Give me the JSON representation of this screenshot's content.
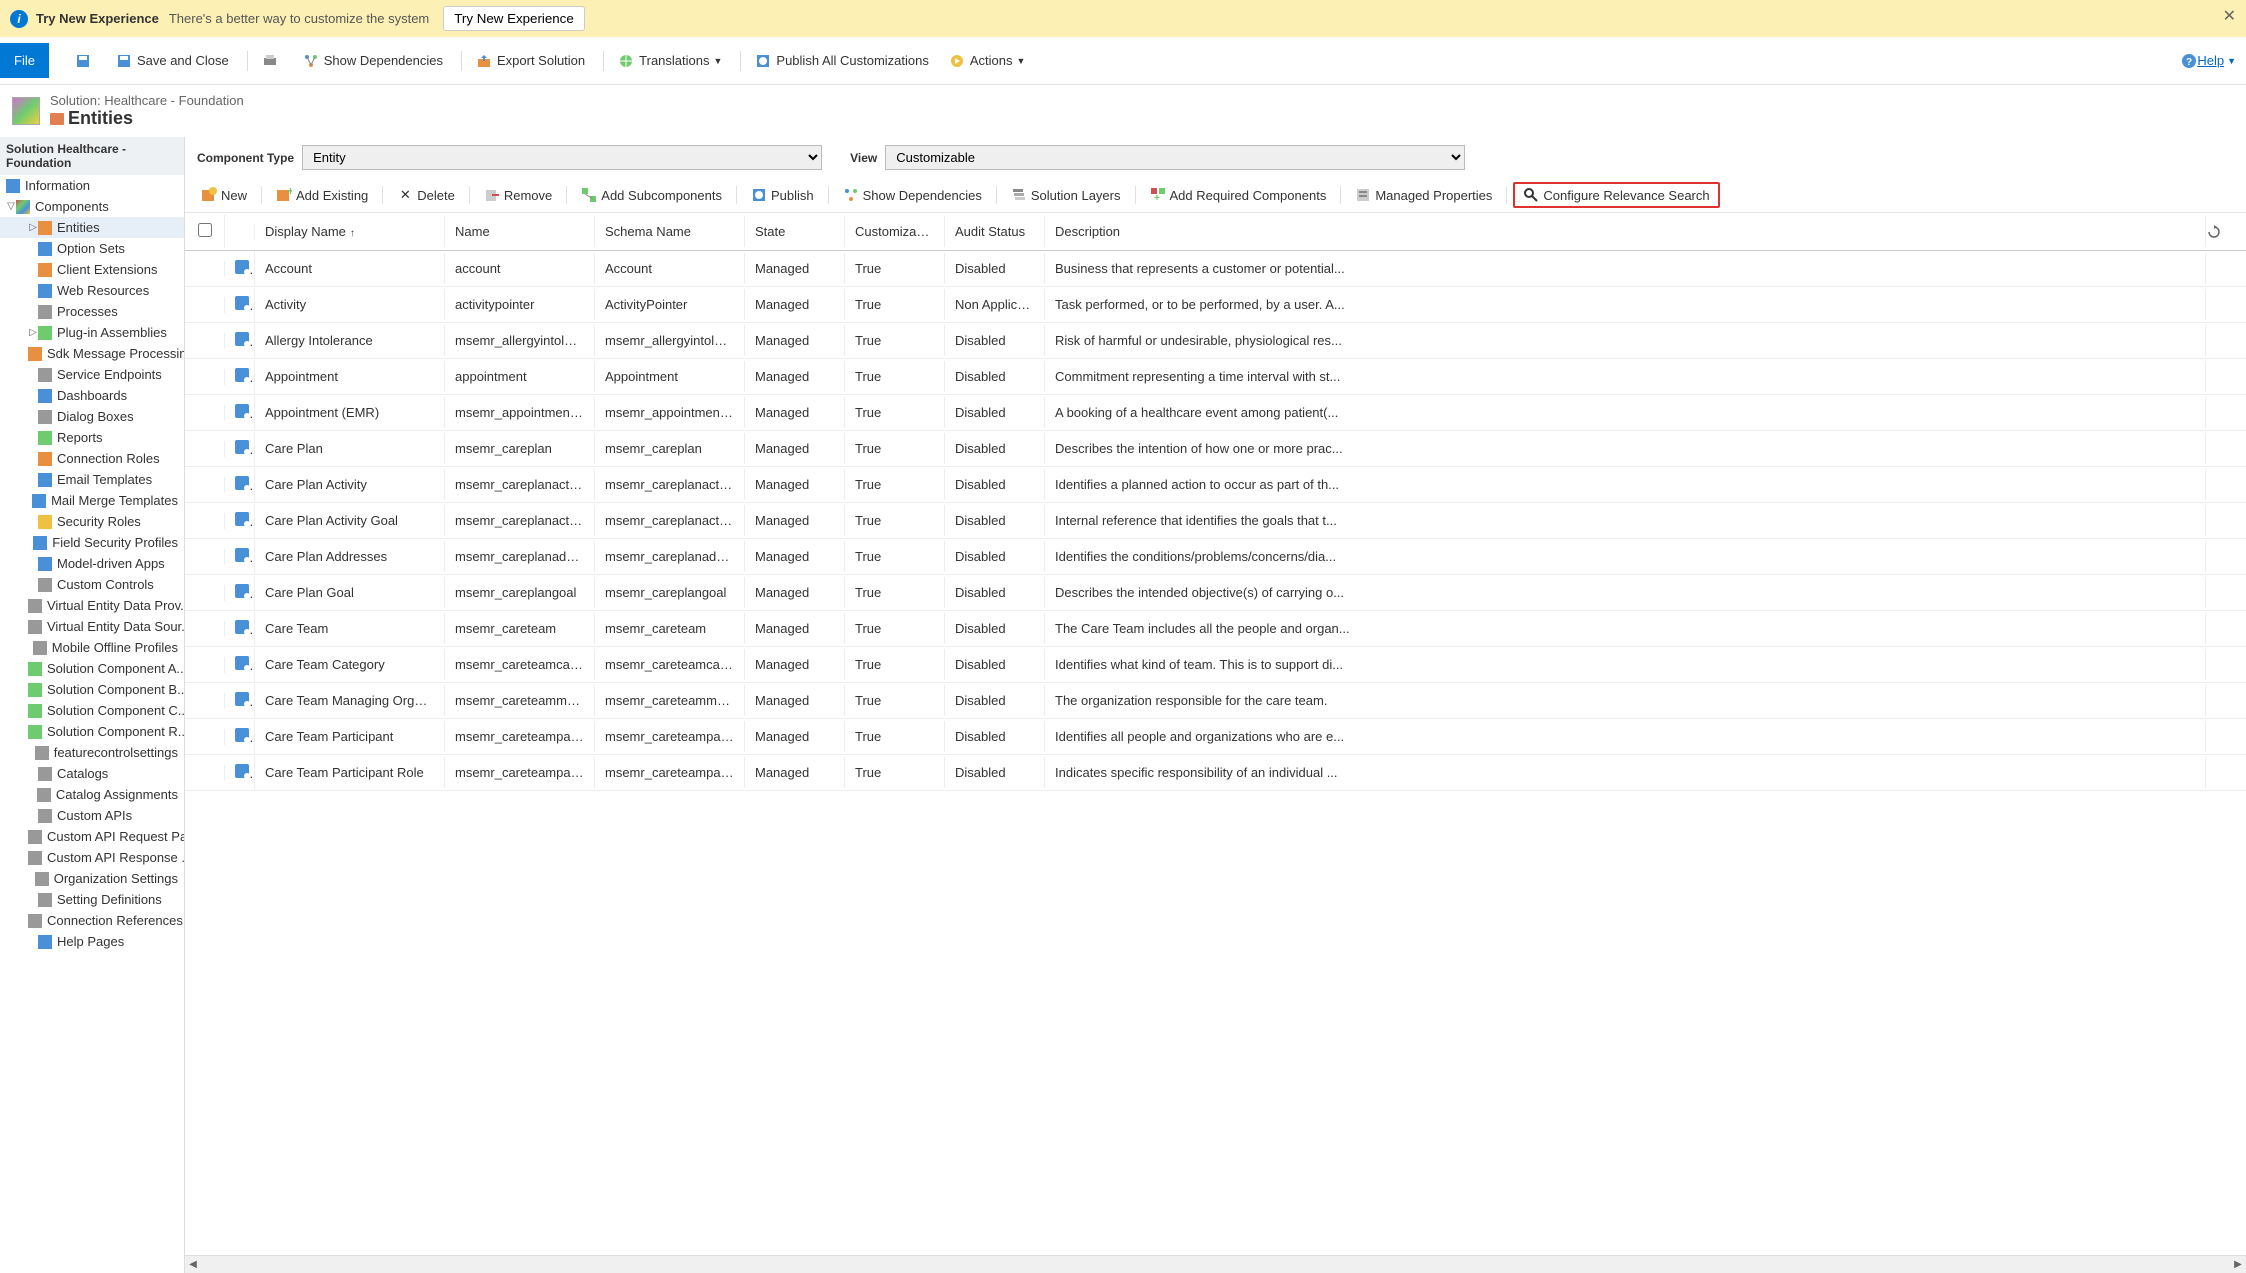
{
  "banner": {
    "title": "Try New Experience",
    "subtitle": "There's a better way to customize the system",
    "button": "Try New Experience"
  },
  "topbar": {
    "file": "File",
    "save_close": "Save and Close",
    "show_deps": "Show Dependencies",
    "export": "Export Solution",
    "translations": "Translations",
    "publish_all": "Publish All Customizations",
    "actions": "Actions",
    "help": "Help"
  },
  "solution": {
    "breadcrumb": "Solution: Healthcare - Foundation",
    "heading": "Entities"
  },
  "sidebar": {
    "header": "Solution Healthcare - Foundation",
    "items": [
      {
        "label": "Information",
        "icon": "i-blue",
        "indent": 0
      },
      {
        "label": "Components",
        "icon": "i-multi",
        "indent": 0,
        "exp": "▽"
      },
      {
        "label": "Entities",
        "icon": "i-orange",
        "indent": 2,
        "exp": "▷",
        "selected": true
      },
      {
        "label": "Option Sets",
        "icon": "i-blue",
        "indent": 2
      },
      {
        "label": "Client Extensions",
        "icon": "i-orange",
        "indent": 2
      },
      {
        "label": "Web Resources",
        "icon": "i-blue",
        "indent": 2
      },
      {
        "label": "Processes",
        "icon": "i-gray",
        "indent": 2
      },
      {
        "label": "Plug-in Assemblies",
        "icon": "i-green",
        "indent": 2,
        "exp": "▷"
      },
      {
        "label": "Sdk Message Processin...",
        "icon": "i-orange",
        "indent": 2
      },
      {
        "label": "Service Endpoints",
        "icon": "i-gray",
        "indent": 2
      },
      {
        "label": "Dashboards",
        "icon": "i-blue",
        "indent": 2
      },
      {
        "label": "Dialog Boxes",
        "icon": "i-gray",
        "indent": 2
      },
      {
        "label": "Reports",
        "icon": "i-green",
        "indent": 2
      },
      {
        "label": "Connection Roles",
        "icon": "i-orange",
        "indent": 2
      },
      {
        "label": "Email Templates",
        "icon": "i-blue",
        "indent": 2
      },
      {
        "label": "Mail Merge Templates",
        "icon": "i-blue",
        "indent": 2
      },
      {
        "label": "Security Roles",
        "icon": "i-yellow",
        "indent": 2
      },
      {
        "label": "Field Security Profiles",
        "icon": "i-blue",
        "indent": 2
      },
      {
        "label": "Model-driven Apps",
        "icon": "i-blue",
        "indent": 2
      },
      {
        "label": "Custom Controls",
        "icon": "i-gray",
        "indent": 2
      },
      {
        "label": "Virtual Entity Data Prov...",
        "icon": "i-gray",
        "indent": 2
      },
      {
        "label": "Virtual Entity Data Sour...",
        "icon": "i-gray",
        "indent": 2
      },
      {
        "label": "Mobile Offline Profiles",
        "icon": "i-gray",
        "indent": 2
      },
      {
        "label": "Solution Component A...",
        "icon": "i-green",
        "indent": 2
      },
      {
        "label": "Solution Component B...",
        "icon": "i-green",
        "indent": 2
      },
      {
        "label": "Solution Component C...",
        "icon": "i-green",
        "indent": 2
      },
      {
        "label": "Solution Component R...",
        "icon": "i-green",
        "indent": 2
      },
      {
        "label": "featurecontrolsettings",
        "icon": "i-gray",
        "indent": 2
      },
      {
        "label": "Catalogs",
        "icon": "i-gray",
        "indent": 2
      },
      {
        "label": "Catalog Assignments",
        "icon": "i-gray",
        "indent": 2
      },
      {
        "label": "Custom APIs",
        "icon": "i-gray",
        "indent": 2
      },
      {
        "label": "Custom API Request Pa...",
        "icon": "i-gray",
        "indent": 2
      },
      {
        "label": "Custom API Response ...",
        "icon": "i-gray",
        "indent": 2
      },
      {
        "label": "Organization Settings",
        "icon": "i-gray",
        "indent": 2
      },
      {
        "label": "Setting Definitions",
        "icon": "i-gray",
        "indent": 2
      },
      {
        "label": "Connection References",
        "icon": "i-gray",
        "indent": 2
      },
      {
        "label": "Help Pages",
        "icon": "i-blue",
        "indent": 2
      }
    ]
  },
  "filters": {
    "ct_label": "Component Type",
    "ct_value": "Entity",
    "view_label": "View",
    "view_value": "Customizable"
  },
  "grid_toolbar": {
    "new": "New",
    "add_existing": "Add Existing",
    "delete": "Delete",
    "remove": "Remove",
    "add_sub": "Add Subcomponents",
    "publish": "Publish",
    "show_deps": "Show Dependencies",
    "layers": "Solution Layers",
    "add_req": "Add Required Components",
    "managed_props": "Managed Properties",
    "configure_relevance": "Configure Relevance Search"
  },
  "grid": {
    "headers": {
      "display_name": "Display Name",
      "name": "Name",
      "schema": "Schema Name",
      "state": "State",
      "cust": "Customizable...",
      "audit": "Audit Status",
      "desc": "Description"
    },
    "rows": [
      {
        "dn": "Account",
        "name": "account",
        "schema": "Account",
        "state": "Managed",
        "cust": "True",
        "audit": "Disabled",
        "desc": "Business that represents a customer or potential..."
      },
      {
        "dn": "Activity",
        "name": "activitypointer",
        "schema": "ActivityPointer",
        "state": "Managed",
        "cust": "True",
        "audit": "Non Applicable",
        "desc": "Task performed, or to be performed, by a user. A..."
      },
      {
        "dn": "Allergy Intolerance",
        "name": "msemr_allergyintolera...",
        "schema": "msemr_allergyintolera...",
        "state": "Managed",
        "cust": "True",
        "audit": "Disabled",
        "desc": "Risk of harmful or undesirable, physiological res..."
      },
      {
        "dn": "Appointment",
        "name": "appointment",
        "schema": "Appointment",
        "state": "Managed",
        "cust": "True",
        "audit": "Disabled",
        "desc": "Commitment representing a time interval with st..."
      },
      {
        "dn": "Appointment (EMR)",
        "name": "msemr_appointmente...",
        "schema": "msemr_appointmente...",
        "state": "Managed",
        "cust": "True",
        "audit": "Disabled",
        "desc": "A booking of a healthcare event among patient(..."
      },
      {
        "dn": "Care Plan",
        "name": "msemr_careplan",
        "schema": "msemr_careplan",
        "state": "Managed",
        "cust": "True",
        "audit": "Disabled",
        "desc": "Describes the intention of how one or more prac..."
      },
      {
        "dn": "Care Plan Activity",
        "name": "msemr_careplanactivity",
        "schema": "msemr_careplanactivity",
        "state": "Managed",
        "cust": "True",
        "audit": "Disabled",
        "desc": "Identifies a planned action to occur as part of th..."
      },
      {
        "dn": "Care Plan Activity Goal",
        "name": "msemr_careplanactivit...",
        "schema": "msemr_careplanactivit...",
        "state": "Managed",
        "cust": "True",
        "audit": "Disabled",
        "desc": "Internal reference that identifies the goals that t..."
      },
      {
        "dn": "Care Plan Addresses",
        "name": "msemr_careplanaddre...",
        "schema": "msemr_careplanaddre...",
        "state": "Managed",
        "cust": "True",
        "audit": "Disabled",
        "desc": "Identifies the conditions/problems/concerns/dia..."
      },
      {
        "dn": "Care Plan Goal",
        "name": "msemr_careplangoal",
        "schema": "msemr_careplangoal",
        "state": "Managed",
        "cust": "True",
        "audit": "Disabled",
        "desc": "Describes the intended objective(s) of carrying o..."
      },
      {
        "dn": "Care Team",
        "name": "msemr_careteam",
        "schema": "msemr_careteam",
        "state": "Managed",
        "cust": "True",
        "audit": "Disabled",
        "desc": "The Care Team includes all the people and organ..."
      },
      {
        "dn": "Care Team Category",
        "name": "msemr_careteamcateg...",
        "schema": "msemr_careteamcateg...",
        "state": "Managed",
        "cust": "True",
        "audit": "Disabled",
        "desc": "Identifies what kind of team. This is to support di..."
      },
      {
        "dn": "Care Team Managing Organiza...",
        "name": "msemr_careteammana...",
        "schema": "msemr_careteammana...",
        "state": "Managed",
        "cust": "True",
        "audit": "Disabled",
        "desc": "The organization responsible for the care team."
      },
      {
        "dn": "Care Team Participant",
        "name": "msemr_careteamparti...",
        "schema": "msemr_careteamparti...",
        "state": "Managed",
        "cust": "True",
        "audit": "Disabled",
        "desc": "Identifies all people and organizations who are e..."
      },
      {
        "dn": "Care Team Participant Role",
        "name": "msemr_careteamparti...",
        "schema": "msemr_careteamparti...",
        "state": "Managed",
        "cust": "True",
        "audit": "Disabled",
        "desc": "Indicates specific responsibility of an individual ..."
      }
    ]
  }
}
